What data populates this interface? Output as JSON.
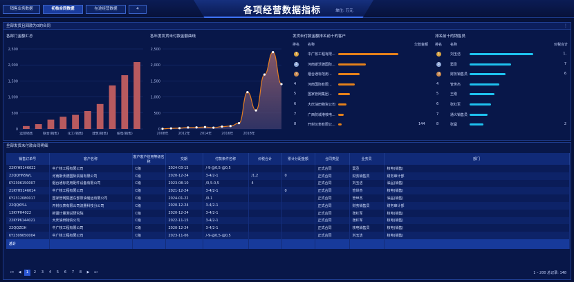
{
  "tabs": [
    {
      "label": "销售业务数据",
      "active": false
    },
    {
      "label": "初核合同数据",
      "active": true
    },
    {
      "label": "在途经营数据",
      "active": false
    },
    {
      "label": "4",
      "active": false
    }
  ],
  "header": {
    "title": "各项经营数据指标",
    "unit": "单位: 万元"
  },
  "panel_top": {
    "title": "全部发货且回款为0的合同",
    "more": "⋮"
  },
  "chart1": {
    "title": "各部门金额汇总",
    "chart_data": {
      "type": "bar",
      "categories": [
        "运营销售",
        "",
        "联合(销售)",
        "",
        "化工(销售)",
        "",
        "建筑(销售)",
        "",
        "核电(销售)",
        ""
      ],
      "values": [
        90,
        150,
        290,
        380,
        440,
        560,
        780,
        1360,
        1680,
        2090
      ],
      "ylim": [
        0,
        2500
      ],
      "yticks": [
        "0",
        "500",
        "1,000",
        "1,500",
        "2,000",
        "2,500"
      ],
      "color": "#b85a5f"
    }
  },
  "chart2": {
    "title": "各年度发货未付款金额曲线",
    "chart_data": {
      "type": "area",
      "x": [
        "2008年",
        "",
        "2012年",
        "",
        "2014年",
        "",
        "2016年",
        "",
        "2018年",
        "",
        "",
        ""
      ],
      "values": [
        5,
        18,
        25,
        45,
        48,
        60,
        40,
        72,
        90,
        180,
        1150,
        580,
        1700,
        2400,
        1400
      ],
      "ylim": [
        0,
        2500
      ],
      "yticks": [
        "0",
        "500",
        "1,000",
        "1,500",
        "2,000",
        "2,500"
      ],
      "color": "#e67e22"
    }
  },
  "rank_customers": {
    "title": "发货未付款金额排名前十的客户",
    "col_rank": "排名",
    "col_name": "名称",
    "col_value": "欠款金额",
    "items": [
      {
        "rank": "1",
        "name": "中广核工程有限...",
        "pct": 0.95
      },
      {
        "rank": "2",
        "name": "河南斯沃德国际...",
        "pct": 0.43
      },
      {
        "rank": "3",
        "name": "烟台通标范用...",
        "pct": 0.34
      },
      {
        "rank": "4",
        "name": "河南国际有限...",
        "pct": 0.26
      },
      {
        "rank": "5",
        "name": "国家管网集团...",
        "pct": 0.18
      },
      {
        "rank": "6",
        "name": "大庆油田物资公司",
        "pct": 0.13
      },
      {
        "rank": "7",
        "name": "广西防城港核电...",
        "pct": 0.09
      },
      {
        "rank": "8",
        "name": "开封仪表有限公...",
        "pct": 0.05
      }
    ],
    "last_value": "144",
    "bar_color": "#e6821a"
  },
  "rank_sales": {
    "title": "排名前十的销售员",
    "col_rank": "排名",
    "col_name": "名称",
    "col_value": "价税合计",
    "items": [
      {
        "rank": "1",
        "name": "刘玉洁",
        "value": "1,",
        "pct": 0.92
      },
      {
        "rank": "2",
        "name": "窦丞",
        "value": "7",
        "pct": 0.6
      },
      {
        "rank": "3",
        "name": "财务销售员",
        "value": "6",
        "pct": 0.52
      },
      {
        "rank": "4",
        "name": "管世杰",
        "value": "",
        "pct": 0.43
      },
      {
        "rank": "5",
        "name": "王刚",
        "value": "",
        "pct": 0.36
      },
      {
        "rank": "6",
        "name": "张红军",
        "value": "",
        "pct": 0.31
      },
      {
        "rank": "7",
        "name": "通义销售员",
        "value": "",
        "pct": 0.26
      },
      {
        "rank": "8",
        "name": "张猛",
        "value": "2",
        "pct": 0.2
      }
    ],
    "bar_color": "#1ec3f0"
  },
  "table": {
    "title": "全部发货未付款合同明细",
    "headers": [
      "销售订单号",
      "客户名称",
      "客户客户信用等级名称",
      "交期",
      "付款条件名称",
      "价税合计",
      "累计分配金额",
      "合同类型",
      "业务员",
      "部门"
    ],
    "rows": [
      [
        "22KYH5146022",
        "中广核工程有限公司",
        "C级",
        "2024-03-15",
        "/-9-@0,5-@0,5",
        "",
        "",
        "正式合同",
        "窦丞",
        "核电(销售)"
      ],
      [
        "22QQHNSWL",
        "河南斯沃德国际贸易有限公司",
        "C级",
        "2020-12-24",
        "3-4/2-1",
        "/1,2",
        "0",
        "正式合同",
        "财务销售员",
        "财务审计部"
      ],
      [
        "KY2306150007",
        "烟台通标范用配件设备有限公司",
        "C级",
        "2023-08-10",
        "/0,5-0,5",
        "4",
        "",
        "正式合同",
        "刘玉洁",
        "油品(销售)"
      ],
      [
        "21KYH5146014",
        "中广核工程有限公司",
        "C级",
        "2021-12-24",
        "3-4/2-1",
        "",
        "0",
        "正式合同",
        "管世杰",
        "核电(销售)"
      ],
      [
        "KY2312080017",
        "国家管网集团东部原油储运有限公司",
        "C级",
        "2024-01-22",
        "/0-1",
        "",
        "",
        "正式合同",
        "管世杰",
        "油品(销售)"
      ],
      [
        "22QQKYLL",
        "开封仪表有限公司流量科技分公司",
        "C级",
        "2020-12-24",
        "3-4/2-1",
        "",
        "",
        "正式合同",
        "财务销售员",
        "财务审计部"
      ],
      [
        "13KYPH4022",
        "新疆计量测试研究院",
        "C级",
        "2020-12-24",
        "3-4/2-1",
        "",
        "",
        "正式合同",
        "张红军",
        "核电(销售)"
      ],
      [
        "22KYP6144021",
        "大庆油田物资公司",
        "C级",
        "2022-11-15",
        "3-4/2-1",
        "",
        "",
        "正式合同",
        "张红军",
        "核电(销售)"
      ],
      [
        "22QQZGH",
        "中广核工程有限公司",
        "C级",
        "2020-12-24",
        "3-4/2-1",
        "",
        "",
        "正式合同",
        "核电销售员",
        "核电(销售)"
      ],
      [
        "KY2309050004",
        "中广核工程有限公司",
        "C级",
        "2023-11-06",
        "/-9-@0,5-@0,5",
        "",
        "",
        "正式合同",
        "刘玉洁",
        "核电(销售)"
      ]
    ],
    "total_label": "总计"
  },
  "pager": {
    "first": "⏮",
    "prev": "◀",
    "pages": [
      "1",
      "2",
      "3",
      "4",
      "5",
      "6",
      "7",
      "8"
    ],
    "next": "▶",
    "last": "⏭",
    "info": "1 – 200 总记录: 148"
  }
}
